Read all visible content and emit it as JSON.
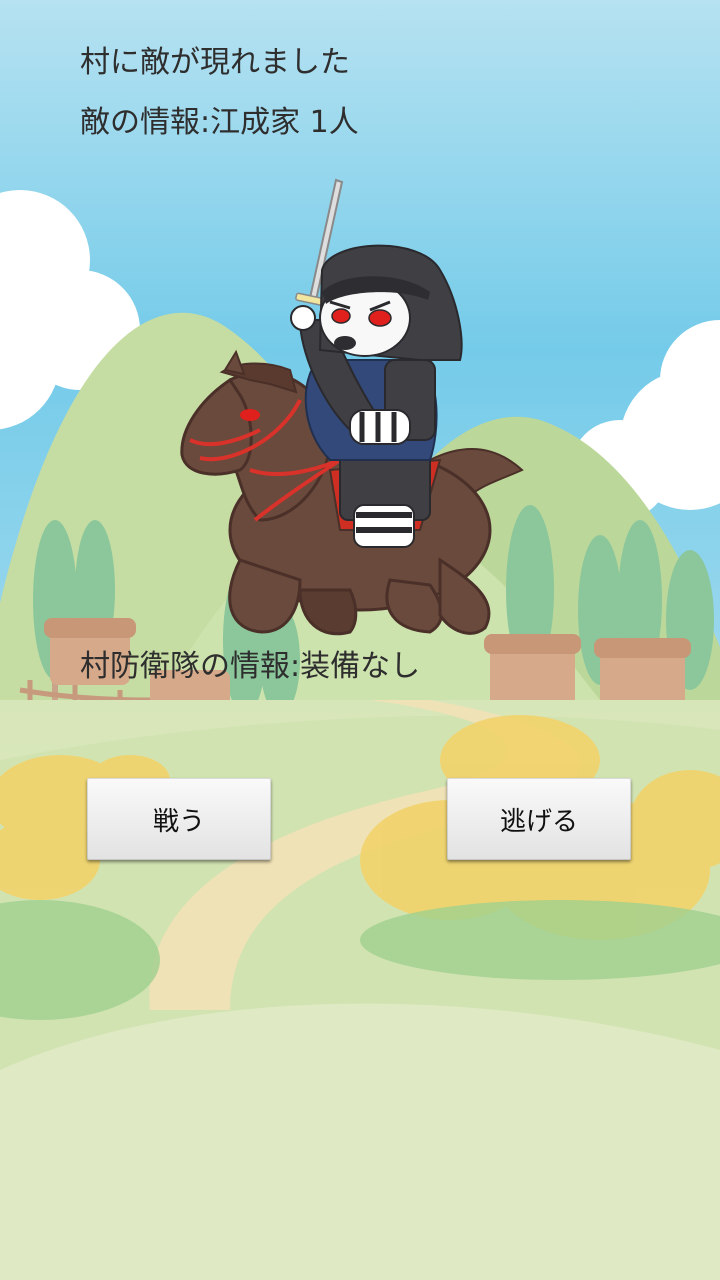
{
  "messages": {
    "line1": "村に敵が現れました",
    "line2": "敵の情報:江成家 1人",
    "line3": "村防衛隊の情報:装備なし"
  },
  "buttons": {
    "fight": "戦う",
    "flee": "逃げる"
  },
  "colors": {
    "sky": "#6ec9e8",
    "hills": "#c9dfa6",
    "horse": "#6a4a3c",
    "armor": "#3f3f44",
    "eyes": "#e0201c",
    "flowers": "#f4d56a"
  }
}
